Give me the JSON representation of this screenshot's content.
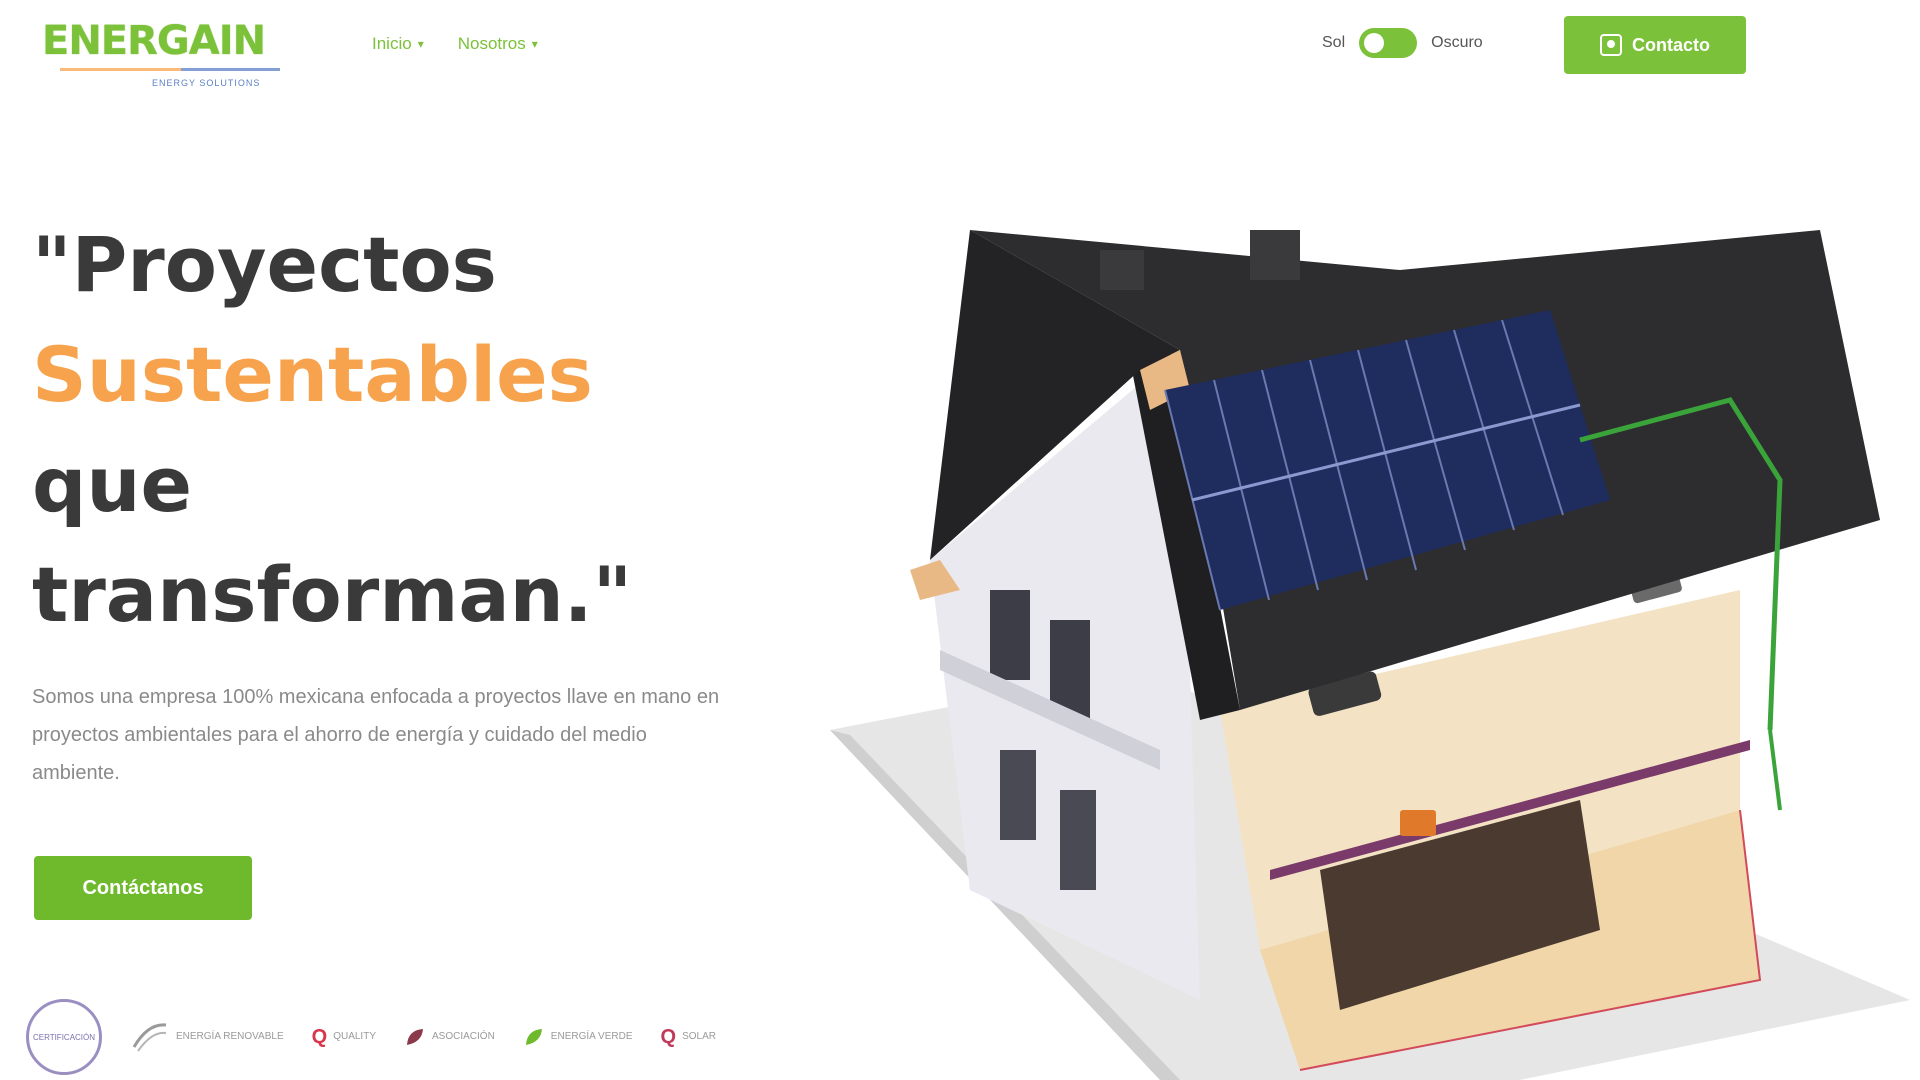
{
  "header": {
    "logo_text": "ENERGAIN",
    "logo_tagline": "ENERGY SOLUTIONS",
    "nav": [
      {
        "label": "Inicio"
      },
      {
        "label": "Nosotros"
      }
    ],
    "mode_toggle": {
      "left_label": "Sol",
      "right_label": "Oscuro",
      "state": "light"
    },
    "contact_label": "Contacto"
  },
  "hero": {
    "title_line1": "\"Proyectos",
    "title_line2": "Sustentables",
    "title_line3": "que",
    "title_line4": "transforman.\"",
    "description": "Somos una empresa 100% mexicana enfocada a proyectos llave en mano en proyectos ambientales para el ahorro de energía y cuidado del medio ambiente.",
    "cta_label": "Contáctanos"
  },
  "partners": [
    {
      "name": "seal-logo",
      "mark": "",
      "text": "CERTIFICACIÓN"
    },
    {
      "name": "partner-2",
      "mark": "",
      "text": "ENERGÍA RENOVABLE"
    },
    {
      "name": "partner-3",
      "mark": "Q",
      "text": "QUALITY"
    },
    {
      "name": "partner-4",
      "mark": "",
      "text": "ASOCIACIÓN"
    },
    {
      "name": "partner-5",
      "mark": "",
      "text": "ENERGÍA VERDE"
    },
    {
      "name": "partner-6",
      "mark": "Q",
      "text": "SOLAR"
    }
  ],
  "colors": {
    "brand_green": "#7cc13a",
    "accent_orange": "#f7a34e",
    "text_dark": "#3a3a3a",
    "text_muted": "#8a8a8a"
  }
}
